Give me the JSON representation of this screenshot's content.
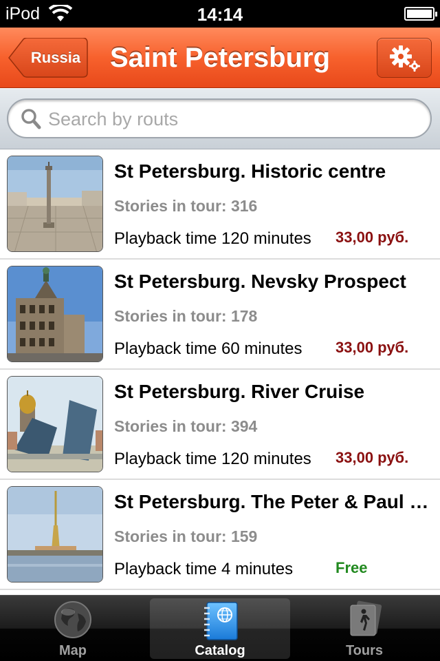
{
  "status_bar": {
    "carrier": "iPod",
    "time": "14:14"
  },
  "nav": {
    "back_label": "Russia",
    "title": "Saint Petersburg",
    "settings_icon": "gears-icon"
  },
  "search": {
    "placeholder": "Search by routs",
    "value": ""
  },
  "tours": [
    {
      "title": "St Petersburg. Historic centre",
      "stories": "Stories in tour: 316",
      "playback": "Playback time 120 minutes",
      "price": "33,00 руб.",
      "free": false
    },
    {
      "title": "St Petersburg. Nevsky Prospect",
      "stories": "Stories in tour: 178",
      "playback": "Playback time 60 minutes",
      "price": "33,00 руб.",
      "free": false
    },
    {
      "title": "St Petersburg. River Cruise",
      "stories": "Stories in tour: 394",
      "playback": "Playback time 120 minutes",
      "price": "33,00 руб.",
      "free": false
    },
    {
      "title": "St Petersburg. The Peter & Paul Fortress",
      "stories": "Stories in tour: 159",
      "playback": "Playback time 4 minutes",
      "price": "Free",
      "free": true
    }
  ],
  "tabbar": {
    "items": [
      {
        "label": "Map",
        "icon": "globe-icon",
        "selected": false
      },
      {
        "label": "Catalog",
        "icon": "catalog-book-icon",
        "selected": true
      },
      {
        "label": "Tours",
        "icon": "walking-person-icon",
        "selected": false
      }
    ]
  },
  "colors": {
    "nav_orange": "#f7612d",
    "price_paid": "#8a1010",
    "price_free": "#21891f",
    "tab_selected": "#ffffff"
  }
}
